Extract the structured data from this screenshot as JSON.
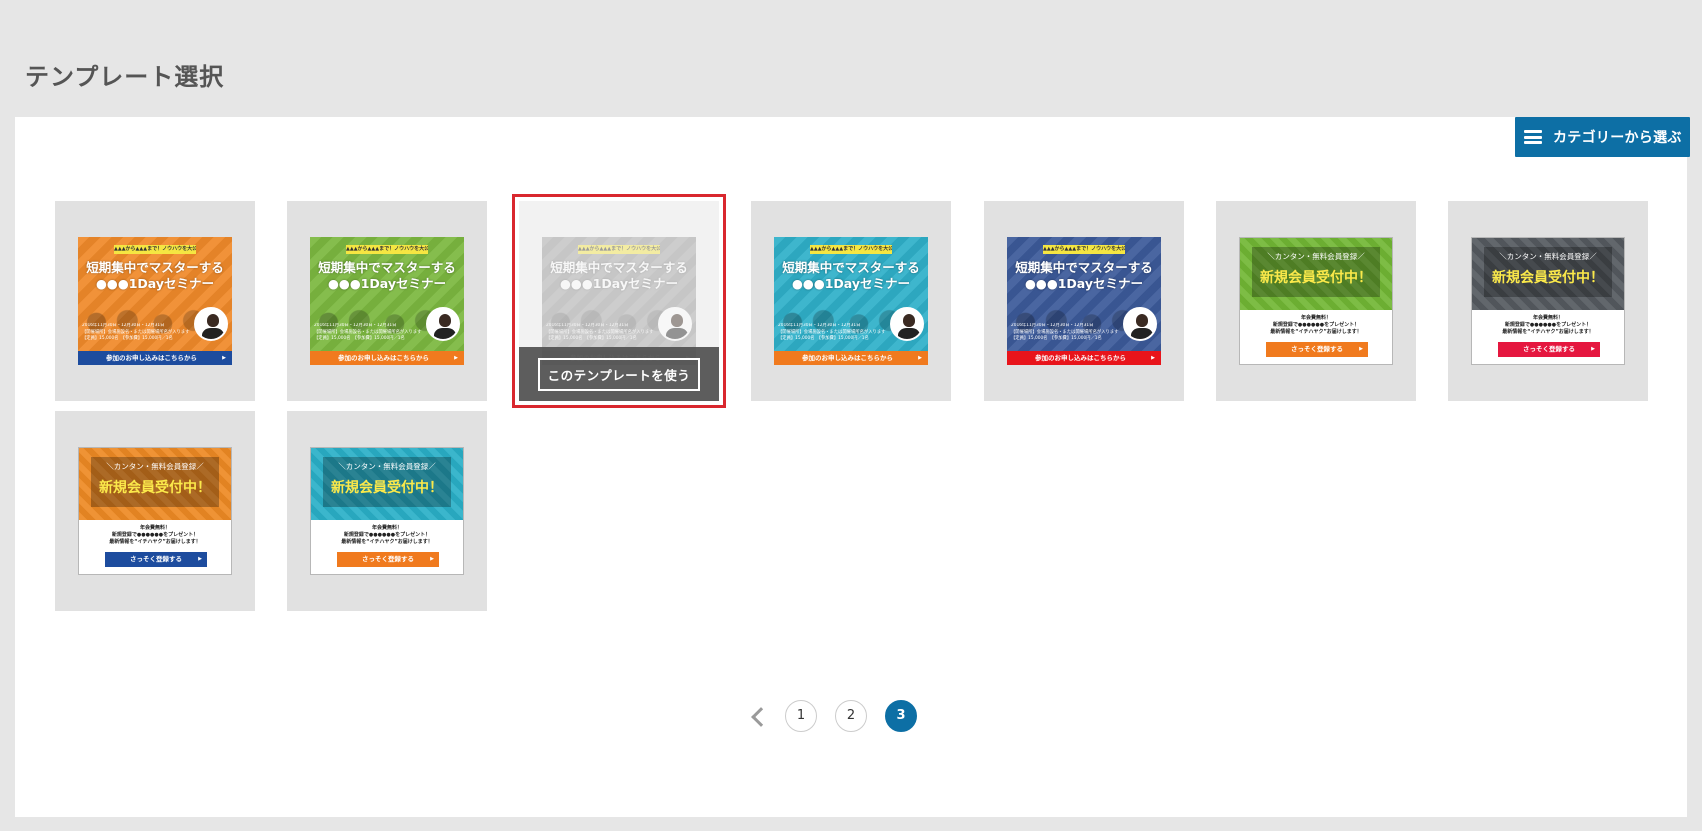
{
  "page": {
    "title": "テンプレート選択"
  },
  "category_button": {
    "label": "カテゴリーから選ぶ",
    "icon": "hamburger-menu-icon"
  },
  "seminar_text": {
    "tag": "▲▲▲から▲▲▲まで！ノウハウを大公開！",
    "line1": "短期集中でマスターする",
    "line2": "●●●1Dayセミナー",
    "info1": "2016年11月30日・12月30日・12月31日",
    "info2": "【開催場所】会場施設名・または開催場所名が入ります",
    "info3": "【定員】15,000名　【参加費】15,000円／1名",
    "cta": "参加のお申し込みはこちらから"
  },
  "member_text": {
    "sub": "＼カンタン・無料会員登録／",
    "main": "新規会員受付中！",
    "l1": "年会費無料！",
    "l2": "新規登録で●●●●●●をプレゼント！",
    "l3": "最新情報を“イチハヤク”お届けします！",
    "cta": "さっそく登録する"
  },
  "templates": [
    {
      "type": "seminar",
      "color": "#f08a2a",
      "bar": "#1d4c9e"
    },
    {
      "type": "seminar",
      "color": "#7cb840",
      "bar": "#f07a1e"
    },
    {
      "type": "seminar",
      "color": "#9a9a9a",
      "bar": "#888888",
      "selected": true
    },
    {
      "type": "seminar",
      "color": "#2fb0c9",
      "bar": "#f07a1e"
    },
    {
      "type": "seminar",
      "color": "#3c5a9a",
      "bar": "#e8141b"
    },
    {
      "type": "member",
      "color": "#72b735",
      "bar": "#f07a1e"
    },
    {
      "type": "member",
      "color": "#555a60",
      "bar": "#e5173f"
    },
    {
      "type": "member",
      "color": "#ee8a24",
      "bar": "#1d4c9e"
    },
    {
      "type": "member",
      "color": "#2ab0c8",
      "bar": "#f07a1e"
    }
  ],
  "overlay": {
    "use_label": "このテンプレートを使う"
  },
  "pagination": {
    "pages": [
      "1",
      "2",
      "3"
    ],
    "current": "3",
    "prev_icon": "chevron-left-icon"
  }
}
